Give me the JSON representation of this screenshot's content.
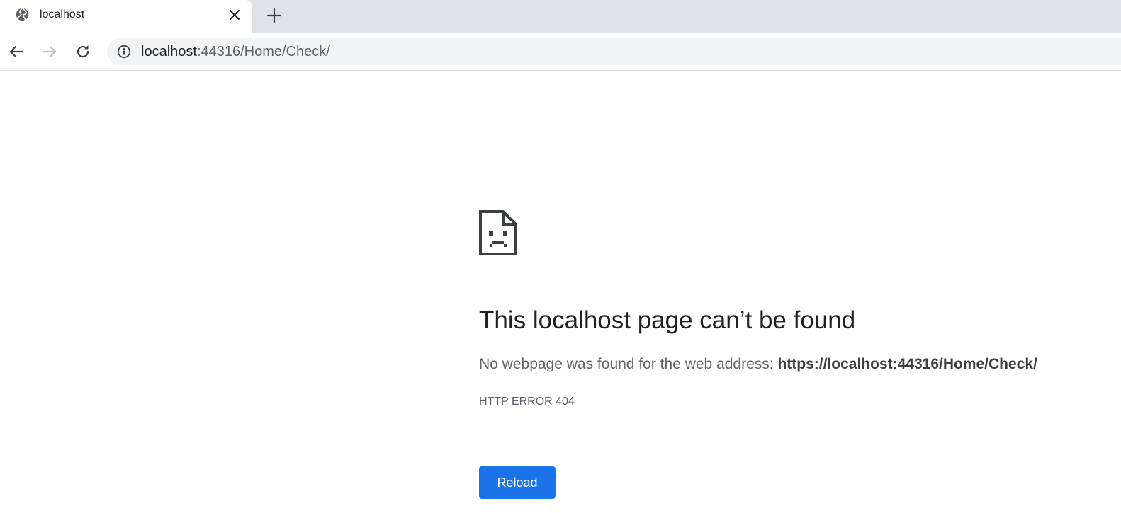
{
  "tab": {
    "title": "localhost",
    "favicon": "globe-icon",
    "close": "close-icon"
  },
  "new_tab": "plus-icon",
  "toolbar": {
    "back": "arrow-left-icon",
    "forward": "arrow-right-icon",
    "reload": "reload-icon",
    "info": "info-icon"
  },
  "omnibox": {
    "host": "localhost",
    "rest": ":44316/Home/Check/"
  },
  "error": {
    "icon": "sad-page-icon",
    "title": "This localhost page can’t be found",
    "description_prefix": "No webpage was found for the web address: ",
    "description_url": "https://localhost:44316/Home/Check/",
    "code": "HTTP ERROR 404",
    "reload_label": "Reload"
  },
  "colors": {
    "tabstrip_bg": "#dee1e6",
    "omnibox_bg": "#f1f3f4",
    "primary_button": "#1a73e8",
    "title_text": "#202124",
    "secondary_text": "#5f6368"
  }
}
